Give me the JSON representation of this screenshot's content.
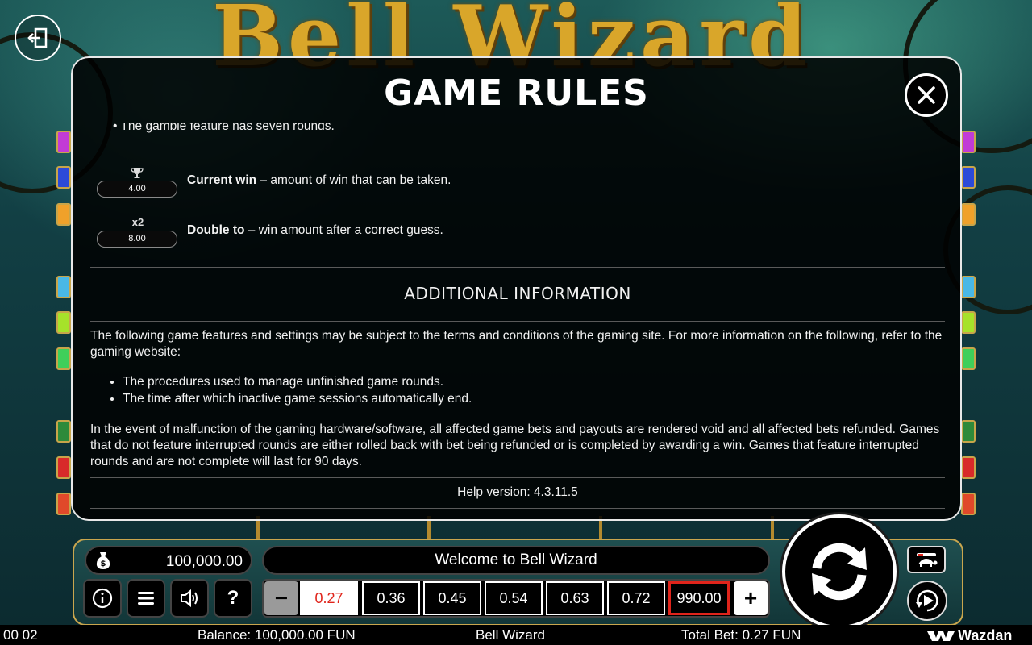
{
  "background": {
    "logo_text": "Bell Wizard"
  },
  "modal": {
    "title": "GAME RULES",
    "clipped_bullet": "The gamble feature has seven rounds.",
    "features": [
      {
        "glyph": "trophy-icon",
        "glyph_text": "🏆",
        "value": "4.00",
        "term": "Current win",
        "desc": " – amount of win that can be taken."
      },
      {
        "glyph": "double-icon",
        "glyph_text": "x2",
        "value": "8.00",
        "term": "Double to",
        "desc": " – win amount after a correct guess."
      }
    ],
    "section_title": "ADDITIONAL INFORMATION",
    "intro": "The following game features and settings may be subject to the terms and conditions of the gaming site. For more information on the following, refer to the gaming website:",
    "bullets": [
      "The procedures used to manage unfinished game rounds.",
      "The time after which inactive game sessions automatically end."
    ],
    "malfunction": "In the event of malfunction of the gaming hardware/software, all affected game bets and payouts are rendered void and all affected bets refunded. Games that do not feature interrupted rounds are either rolled back with bet being refunded or is completed by awarding a win. Games that feature interrupted rounds and are not complete will last for 90 days.",
    "help_version": "Help version: 4.3.11.5"
  },
  "panel": {
    "balance": "100,000.00",
    "message": "Welcome to Bell Wizard",
    "bets": [
      "0.27",
      "0.36",
      "0.45",
      "0.54",
      "0.63",
      "0.72",
      "990.00"
    ],
    "selected_bet": "0.27",
    "minus_label": "−",
    "plus_label": "+",
    "help_label": "?"
  },
  "footer": {
    "time": "00 02",
    "balance": "Balance: 100,000.00 FUN",
    "game": "Bell Wizard",
    "total_bet": "Total Bet: 0.27 FUN",
    "brand": "Wazdan"
  },
  "colors": {
    "accent_red": "#e0241b",
    "panel_gold": "#c9a64e"
  }
}
